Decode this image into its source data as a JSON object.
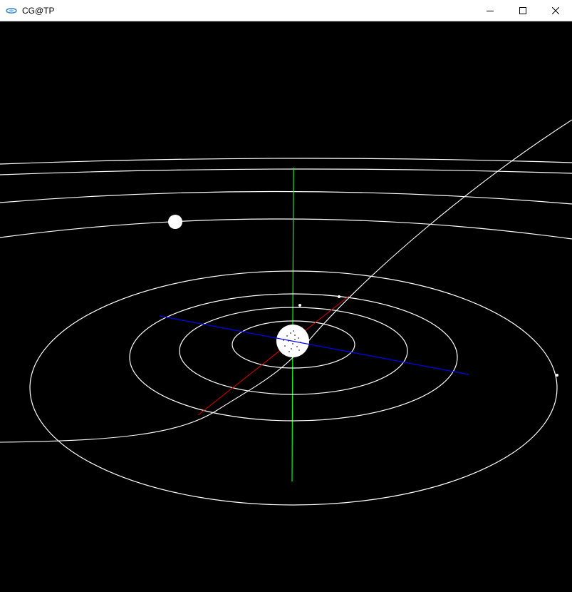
{
  "window": {
    "title": "CG@TP",
    "icon": "app-icon",
    "controls": {
      "minimize": "minimize-icon",
      "maximize": "maximize-icon",
      "close": "close-icon"
    }
  },
  "scene": {
    "background": "#000000",
    "orbit_color": "#ffffff",
    "axis_colors": {
      "x": "#ff0000",
      "y": "#00ff00",
      "z": "#0000ff"
    },
    "sun_color": "#ffffff",
    "planet_color": "#ffffff"
  }
}
